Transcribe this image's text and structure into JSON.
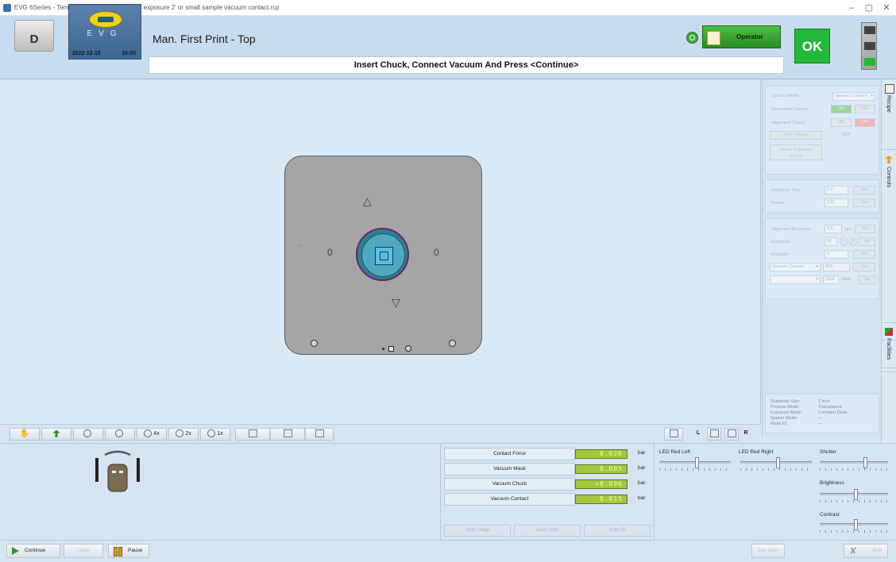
{
  "window": {
    "title": "EVG 6Series - Temporary Registration - flood exposure 2' or small sample vacuum contact.rcp",
    "controls": [
      "–",
      "▢",
      "✕"
    ]
  },
  "header": {
    "d_button": "D",
    "logo_text": "EVG",
    "date": "2022-12-15",
    "time": "15:00",
    "mode_title": "Man. First Print - Top",
    "instruction": "Insert Chuck, Connect Vacuum And Press <Continue>",
    "operator_label": "Operator",
    "ok_label": "OK",
    "colors": {
      "ok": "#23b83a",
      "operator": "#2f9b29"
    }
  },
  "light_tower": [
    "#444444",
    "#444444",
    "#22bb33"
  ],
  "right_panel": {
    "contact_mode_label": "Contact Mode:",
    "contact_mode_value": "Vacuum Contact",
    "separation_control_label": "Separation Control:",
    "on_label": "ON",
    "off_label": "OFF",
    "alignment_chuck_label": "Alignment Chuck:",
    "pec_internal_label": "PEC Internal",
    "pec_internal_value": "OFF",
    "sector_exposure_label": "Sector Exposure",
    "sector_exposure_sub": "(0,0,0)",
    "exposure_time_label": "Exposure Time:",
    "exposure_time_value": "5.0",
    "power_label": "Power:",
    "power_value": "220",
    "set_label": "Set",
    "alignment_accuracy_label": "Alignment Accuracy:",
    "alignment_accuracy_value": "0.5",
    "alignment_accuracy_unit": "µm",
    "exposure_label": "Exposure:",
    "exposure_value": "20",
    "rotation_label": "Rotation:",
    "rotation_value": "0",
    "vacuum_contact_select": "Vacuum Contact",
    "vacuum_value_1": "800",
    "vacuum_value_2": "1500",
    "vacuum_unit": "mbar",
    "info": [
      {
        "k": "Substrate Size:",
        "v": "2 inch"
      },
      {
        "k": "Process Mode:",
        "v": "Transparent"
      },
      {
        "k": "Exposure Mode:",
        "v": "Constant Dose"
      },
      {
        "k": "Spacer Mode:",
        "v": "---"
      },
      {
        "k": "Mask ID:",
        "v": "---"
      }
    ]
  },
  "side_tabs": [
    "Recipe",
    "Controls",
    "Facilities"
  ],
  "toolbar": {
    "zoom_4x": "4x",
    "zoom_2x": "2x",
    "zoom_1x": "1x",
    "left_label": "L",
    "right_label": "R"
  },
  "measurements": [
    {
      "label": "Contact Force",
      "value": "0.026",
      "unit": "bar"
    },
    {
      "label": "Vacuum Mask",
      "value": "0.005",
      "unit": "bar"
    },
    {
      "label": "Vacuum Chuck",
      "value": "+0.096",
      "unit": "bar"
    },
    {
      "label": "Vacuum Contact",
      "value": "0.015",
      "unit": "bar"
    }
  ],
  "scan_buttons": [
    "Scan Stage",
    "Scan Optic",
    "Scan IR"
  ],
  "sliders": {
    "led_red_left": {
      "label": "LED Red Left",
      "level": 0.52
    },
    "led_red_right": {
      "label": "LED Red Right",
      "level": 0.52
    },
    "shutter": {
      "label": "Shutter",
      "level": 0.66
    },
    "brightness": {
      "label": "Brightness",
      "level": 0.52
    },
    "contrast": {
      "label": "Contrast",
      "level": 0.52
    }
  },
  "statusbar": {
    "continue": "Continue",
    "undo": "Undo",
    "pause": "Pause",
    "sep_cont": "Sep Cont",
    "exit": "Exit"
  }
}
